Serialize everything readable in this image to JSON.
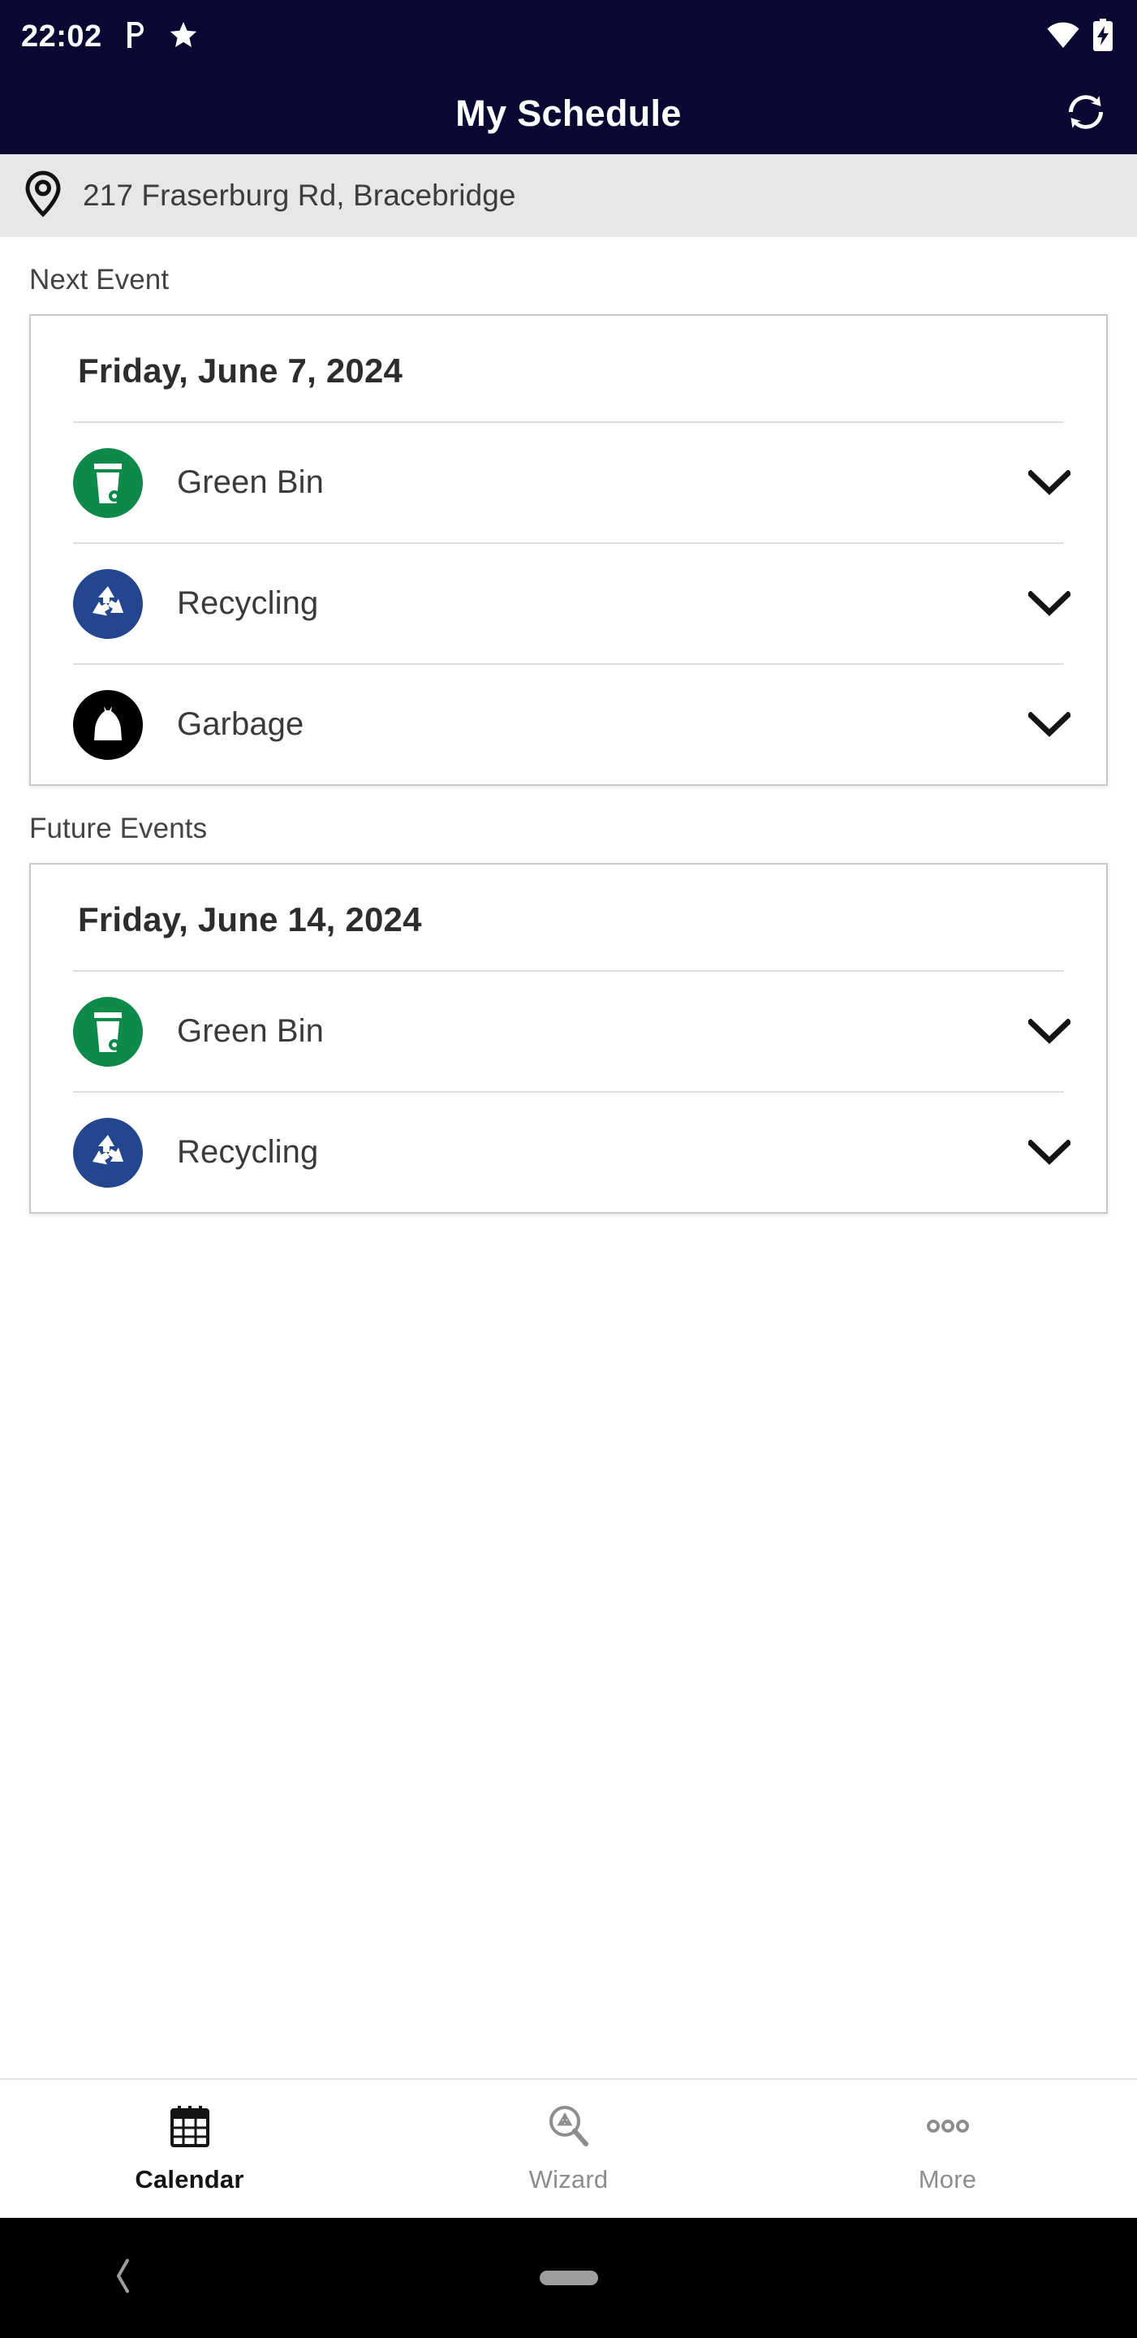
{
  "statusbar": {
    "time": "22:02",
    "left_icons": [
      "parking-p-icon",
      "star-icon"
    ],
    "right_icons": [
      "wifi-icon",
      "battery-charging-icon"
    ]
  },
  "appbar": {
    "title": "My Schedule",
    "action_icon": "refresh-sync-icon"
  },
  "address": {
    "icon": "location-pin-icon",
    "text": "217 Fraserburg Rd, Bracebridge"
  },
  "sections": [
    {
      "title": "Next Event",
      "card": {
        "date": "Friday, June 7, 2024",
        "rows": [
          {
            "label": "Green Bin",
            "icon": "green-bin-icon",
            "color": "#0d8a4a",
            "chevron": "chevron-down-icon"
          },
          {
            "label": "Recycling",
            "icon": "recycling-icon",
            "color": "#23468e",
            "chevron": "chevron-down-icon"
          },
          {
            "label": "Garbage",
            "icon": "garbage-bag-icon",
            "color": "#000000",
            "chevron": "chevron-down-icon"
          }
        ]
      }
    },
    {
      "title": "Future Events",
      "card": {
        "date": "Friday, June 14, 2024",
        "rows": [
          {
            "label": "Green Bin",
            "icon": "green-bin-icon",
            "color": "#0d8a4a",
            "chevron": "chevron-down-icon"
          },
          {
            "label": "Recycling",
            "icon": "recycling-icon",
            "color": "#23468e",
            "chevron": "chevron-down-icon"
          }
        ]
      }
    }
  ],
  "bottomnav": {
    "items": [
      {
        "label": "Calendar",
        "icon": "calendar-icon",
        "active": true
      },
      {
        "label": "Wizard",
        "icon": "recycle-search-icon",
        "active": false
      },
      {
        "label": "More",
        "icon": "more-dots-icon",
        "active": false
      }
    ]
  },
  "androidnav": {
    "back_icon": "back-chevron-icon",
    "home_icon": "home-pill-icon"
  },
  "colors": {
    "header_navy": "#080833",
    "address_bg": "#e7e7e7",
    "green": "#0d8a4a",
    "blue": "#23468e",
    "black": "#000000",
    "card_border": "#c9c9c9"
  }
}
